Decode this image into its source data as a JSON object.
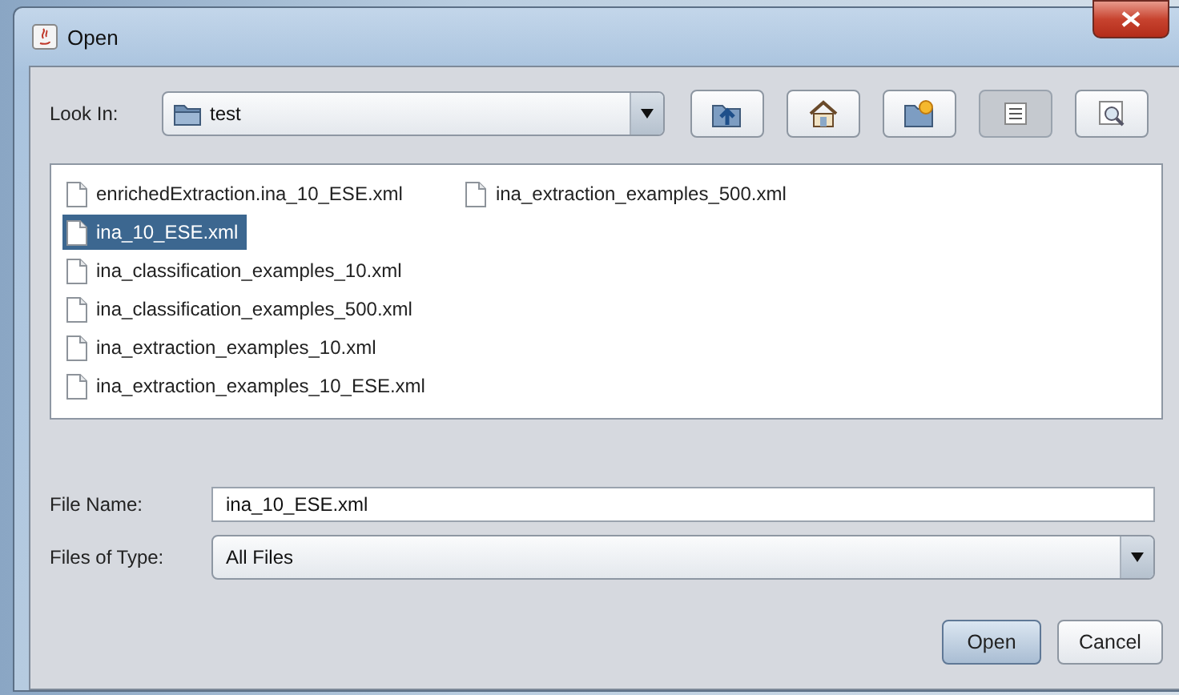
{
  "window": {
    "title": "Open"
  },
  "look_in": {
    "label": "Look In:",
    "value": "test"
  },
  "toolbar": [
    {
      "kind": "up",
      "selected": false
    },
    {
      "kind": "home",
      "selected": false
    },
    {
      "kind": "new-folder",
      "selected": false
    },
    {
      "kind": "list",
      "selected": true
    },
    {
      "kind": "details",
      "selected": false
    }
  ],
  "files": [
    {
      "name": "enrichedExtraction.ina_10_ESE.xml",
      "selected": false
    },
    {
      "name": "ina_10_ESE.xml",
      "selected": true
    },
    {
      "name": "ina_classification_examples_10.xml",
      "selected": false
    },
    {
      "name": "ina_classification_examples_500.xml",
      "selected": false
    },
    {
      "name": "ina_extraction_examples_10.xml",
      "selected": false
    },
    {
      "name": "ina_extraction_examples_10_ESE.xml",
      "selected": false
    },
    {
      "name": "ina_extraction_examples_500.xml",
      "selected": false
    }
  ],
  "file_name": {
    "label": "File Name:",
    "value": "ina_10_ESE.xml"
  },
  "file_type": {
    "label": "Files of Type:",
    "value": "All Files"
  },
  "buttons": [
    {
      "label": "Open",
      "default": true
    },
    {
      "label": "Cancel",
      "default": false
    }
  ]
}
